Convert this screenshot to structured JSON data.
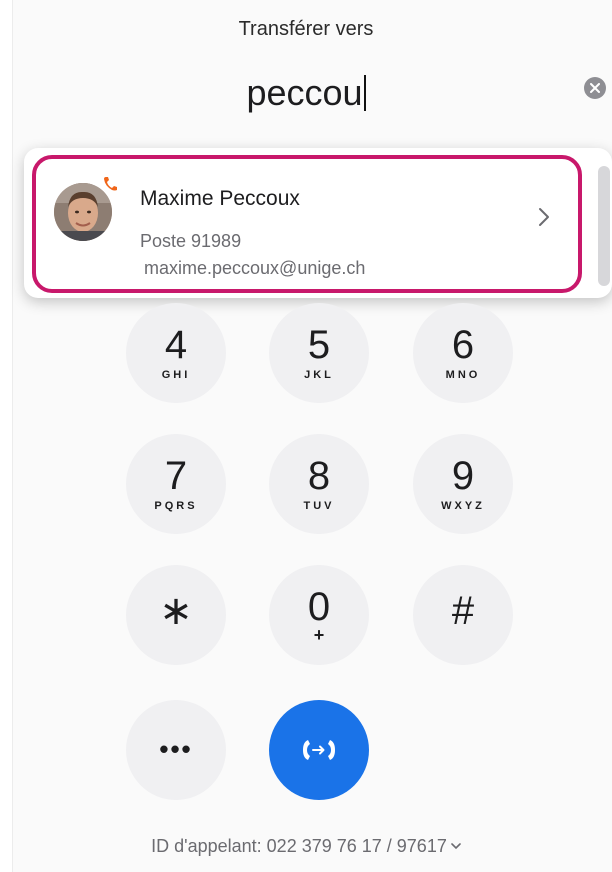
{
  "header": {
    "title": "Transférer vers"
  },
  "search": {
    "value": "peccou"
  },
  "result": {
    "name": "Maxime Peccoux",
    "extension": "Poste 91989",
    "email": "maxime.peccoux@unige.ch"
  },
  "keypad": {
    "keys": [
      {
        "digit": "4",
        "letters": "GHI"
      },
      {
        "digit": "5",
        "letters": "JKL"
      },
      {
        "digit": "6",
        "letters": "MNO"
      },
      {
        "digit": "7",
        "letters": "PQRS"
      },
      {
        "digit": "8",
        "letters": "TUV"
      },
      {
        "digit": "9",
        "letters": "WXYZ"
      },
      {
        "digit": "∗",
        "letters": ""
      },
      {
        "digit": "0",
        "letters": "+"
      },
      {
        "digit": "#",
        "letters": ""
      }
    ],
    "more_label": "•••"
  },
  "footer": {
    "caller_id": "ID d'appelant: 022 379 76 17 / 97617"
  },
  "colors": {
    "highlight": "#c8186b",
    "transfer_button": "#1a73e8",
    "phone_badge": "#f0661a"
  }
}
